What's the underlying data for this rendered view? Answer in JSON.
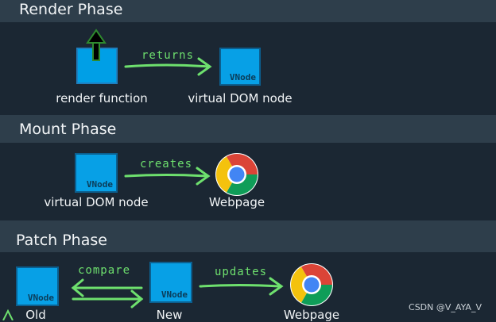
{
  "render_phase": {
    "title": "Render Phase",
    "source_label": "render function",
    "arrow_label": "returns",
    "target_label": "virtual DOM node",
    "vnode_tag": "VNode"
  },
  "mount_phase": {
    "title": "Mount Phase",
    "source_label": "virtual DOM node",
    "arrow_label": "creates",
    "target_label": "Webpage",
    "vnode_tag": "VNode"
  },
  "patch_phase": {
    "title": "Patch Phase",
    "old_label": "Old",
    "compare_label": "compare",
    "new_label": "New",
    "updates_label": "updates",
    "target_label": "Webpage",
    "vnode_tag": "VNode"
  },
  "colors": {
    "band": "#2e3e4b",
    "background": "#1b2733",
    "vnode_fill": "#07a0e6",
    "arrow": "#6ee06e"
  },
  "watermark": "CSDN @V_AYA_V"
}
